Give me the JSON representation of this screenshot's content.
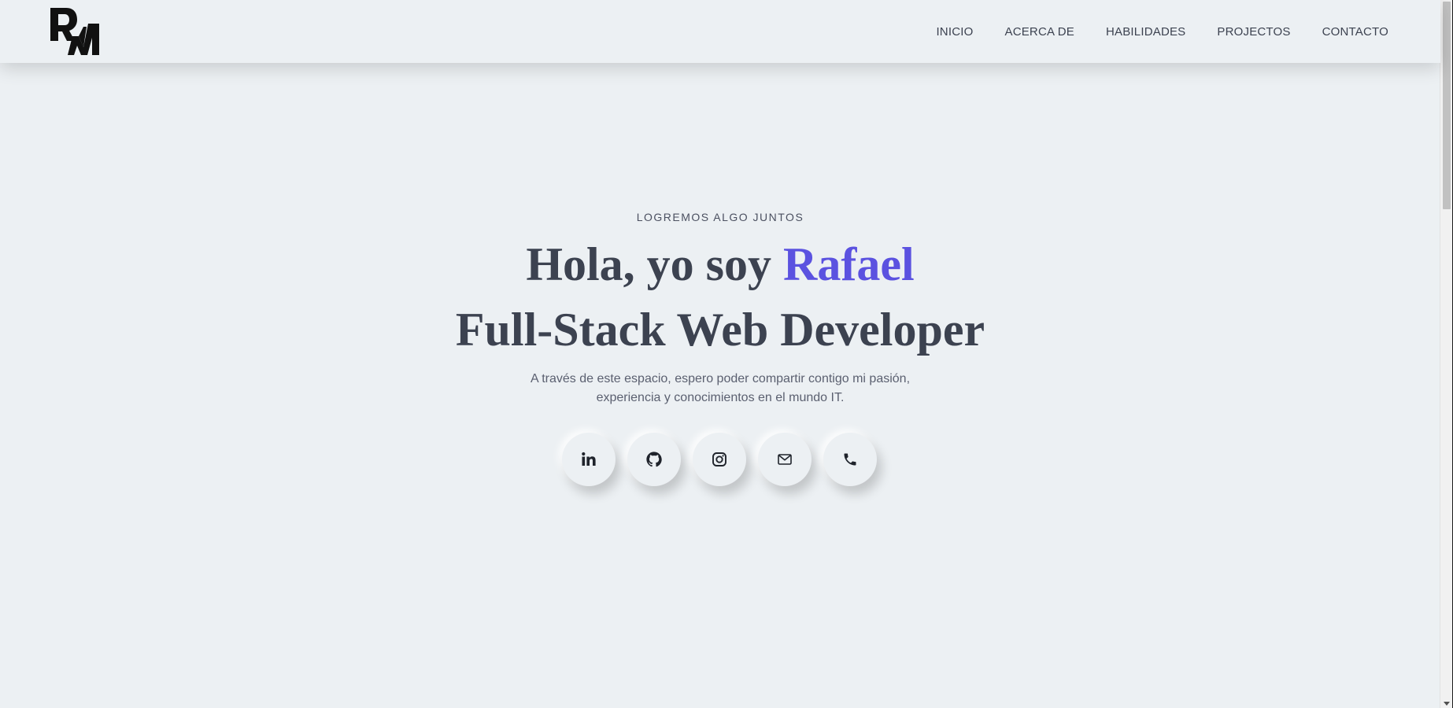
{
  "header": {
    "logo_text": "RM",
    "nav": [
      {
        "label": "INICIO"
      },
      {
        "label": "ACERCA DE"
      },
      {
        "label": "HABILIDADES"
      },
      {
        "label": "PROJECTOS"
      },
      {
        "label": "CONTACTO"
      }
    ]
  },
  "hero": {
    "eyebrow": "LOGREMOS ALGO JUNTOS",
    "greeting": "Hola, yo soy ",
    "name": "Rafael",
    "role": "Full-Stack Web Developer",
    "description_line1": "A través de este espacio, espero poder compartir contigo mi pasión,",
    "description_line2": "experiencia y conocimientos en el mundo IT."
  },
  "socials": [
    {
      "icon": "linkedin-icon"
    },
    {
      "icon": "github-icon"
    },
    {
      "icon": "instagram-icon"
    },
    {
      "icon": "mail-icon"
    },
    {
      "icon": "phone-icon"
    }
  ],
  "colors": {
    "background": "#ecf0f3",
    "text": "#3c4250",
    "accent": "#5b52e0"
  }
}
